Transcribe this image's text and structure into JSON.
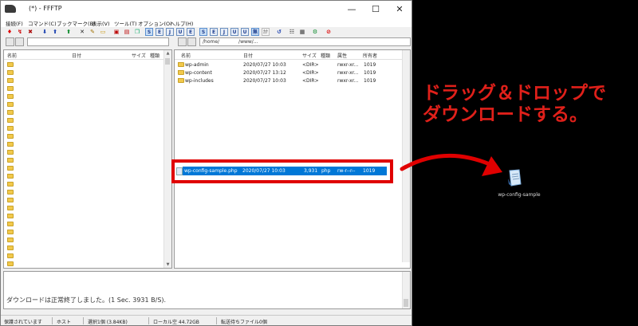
{
  "window": {
    "title": "(*) - FFFTP",
    "controls": {
      "minimize": "—",
      "maximize": "☐",
      "close": "✕"
    }
  },
  "menu": [
    "接続(F)",
    "コマンド(C)",
    "ブックマーク(B)",
    "表示(V)",
    "ツール(T)",
    "オプション(O)",
    "ヘルプ(H)"
  ],
  "toolbar": {
    "transfer_labels": [
      "S",
      "E",
      "J",
      "U",
      "E",
      "J",
      "U"
    ],
    "mode_label": "無",
    "refresh_label": "↺",
    "kana_label": "ｶﾅ"
  },
  "local": {
    "address": "",
    "columns": [
      "名前",
      "日付",
      "サイズ",
      "種類"
    ]
  },
  "remote": {
    "address": "/home/　　　　/www/...",
    "columns": [
      "名前",
      "日付",
      "サイズ",
      "種類",
      "属性",
      "所有者"
    ],
    "rows": [
      {
        "name": "wp-admin",
        "date": "2020/07/27 10:03",
        "size": "<DIR>",
        "type": "",
        "attr": "rwxr-xr...",
        "owner": "1019"
      },
      {
        "name": "wp-content",
        "date": "2020/07/27 13:12",
        "size": "<DIR>",
        "type": "",
        "attr": "rwxr-xr...",
        "owner": "1019"
      },
      {
        "name": "wp-includes",
        "date": "2020/07/27 10:03",
        "size": "<DIR>",
        "type": "",
        "attr": "rwxr-xr...",
        "owner": "1019"
      }
    ],
    "selected_file": {
      "name": "wp-config-sample.php",
      "date": "2020/07/27 10:03",
      "size": "3,931",
      "type": "php",
      "attr": "rw-r--r--",
      "owner": "1019"
    }
  },
  "log": {
    "message": "ダウンロードは正常終了しました。(1 Sec. 3931 B/S)."
  },
  "statusbar": [
    "保護されています",
    "ホスト",
    "選択1個 (3.84KB)",
    "ローカル空 44.72GB",
    "転送待ちファイル0個"
  ],
  "annotation": {
    "line1": "ドラッグ＆ドロップで",
    "line2": "ダウンロードする。",
    "color": "#e0201a"
  },
  "desktop_file": {
    "label": "wp-config-sample"
  }
}
